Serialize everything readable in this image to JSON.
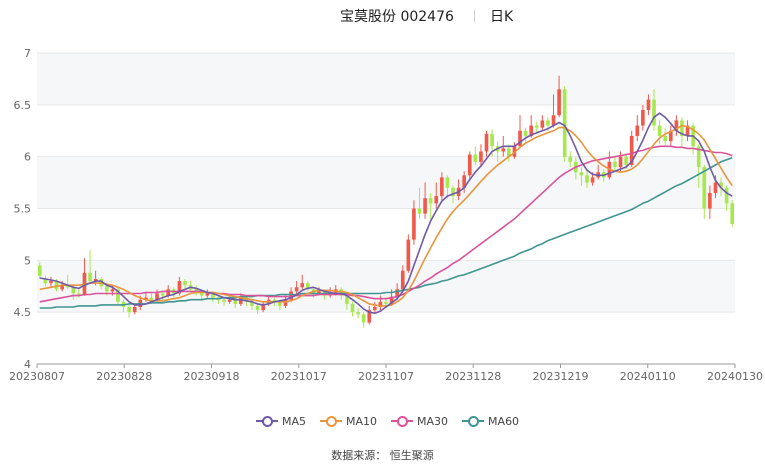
{
  "header": {
    "title": "宝莫股份 002476",
    "period": "日K"
  },
  "source": "数据来源： 恒生聚源",
  "colors": {
    "up": "#f0584a",
    "down": "#a6e84e",
    "ma5": "#6f5aa8",
    "ma10": "#e8953c",
    "ma30": "#d9539c",
    "ma60": "#3f9591",
    "grid": "#e8e8e8",
    "band": "#f6f7f9"
  },
  "chart_data": {
    "type": "candlestick",
    "ylim": [
      4,
      7
    ],
    "yticks": [
      "4",
      "4.5",
      "5",
      "5.5",
      "6",
      "6.5",
      "7"
    ],
    "xticks": [
      "20230807",
      "20230828",
      "20230918",
      "20231017",
      "20231107",
      "20231128",
      "20231219",
      "20240110",
      "20240130"
    ],
    "legend": [
      "MA5",
      "MA10",
      "MA30",
      "MA60"
    ],
    "candles": [
      [
        4.95,
        4.85,
        4.98,
        4.82
      ],
      [
        4.82,
        4.78,
        4.85,
        4.75
      ],
      [
        4.78,
        4.8,
        4.84,
        4.74
      ],
      [
        4.8,
        4.72,
        4.82,
        4.7
      ],
      [
        4.72,
        4.76,
        4.8,
        4.7
      ],
      [
        4.76,
        4.74,
        4.86,
        4.72
      ],
      [
        4.74,
        4.68,
        4.76,
        4.62
      ],
      [
        4.68,
        4.66,
        4.72,
        4.64
      ],
      [
        4.66,
        4.88,
        5.02,
        4.7
      ],
      [
        4.88,
        4.8,
        5.1,
        4.78
      ],
      [
        4.8,
        4.82,
        4.9,
        4.76
      ],
      [
        4.82,
        4.75,
        4.84,
        4.72
      ],
      [
        4.75,
        4.7,
        4.78,
        4.66
      ],
      [
        4.7,
        4.72,
        4.76,
        4.66
      ],
      [
        4.72,
        4.6,
        4.74,
        4.58
      ],
      [
        4.6,
        4.55,
        4.62,
        4.5
      ],
      [
        4.55,
        4.5,
        4.58,
        4.45
      ],
      [
        4.5,
        4.55,
        4.58,
        4.48
      ],
      [
        4.55,
        4.62,
        4.66,
        4.52
      ],
      [
        4.62,
        4.64,
        4.7,
        4.6
      ],
      [
        4.64,
        4.62,
        4.68,
        4.58
      ],
      [
        4.62,
        4.68,
        4.72,
        4.6
      ],
      [
        4.68,
        4.66,
        4.7,
        4.62
      ],
      [
        4.66,
        4.72,
        4.76,
        4.64
      ],
      [
        4.72,
        4.68,
        4.74,
        4.64
      ],
      [
        4.68,
        4.8,
        4.84,
        4.66
      ],
      [
        4.8,
        4.76,
        4.82,
        4.72
      ],
      [
        4.76,
        4.72,
        4.8,
        4.7
      ],
      [
        4.72,
        4.7,
        4.76,
        4.66
      ],
      [
        4.7,
        4.66,
        4.72,
        4.62
      ],
      [
        4.66,
        4.68,
        4.72,
        4.64
      ],
      [
        4.68,
        4.64,
        4.7,
        4.6
      ],
      [
        4.64,
        4.62,
        4.66,
        4.58
      ],
      [
        4.62,
        4.6,
        4.64,
        4.56
      ],
      [
        4.6,
        4.62,
        4.66,
        4.58
      ],
      [
        4.62,
        4.58,
        4.64,
        4.54
      ],
      [
        4.58,
        4.64,
        4.68,
        4.56
      ],
      [
        4.64,
        4.6,
        4.66,
        4.56
      ],
      [
        4.6,
        4.56,
        4.62,
        4.52
      ],
      [
        4.56,
        4.52,
        4.58,
        4.48
      ],
      [
        4.52,
        4.58,
        4.6,
        4.5
      ],
      [
        4.58,
        4.62,
        4.66,
        4.56
      ],
      [
        4.62,
        4.6,
        4.64,
        4.56
      ],
      [
        4.6,
        4.56,
        4.62,
        4.52
      ],
      [
        4.56,
        4.62,
        4.66,
        4.54
      ],
      [
        4.62,
        4.7,
        4.74,
        4.6
      ],
      [
        4.7,
        4.74,
        4.8,
        4.68
      ],
      [
        4.74,
        4.78,
        4.86,
        4.72
      ],
      [
        4.78,
        4.72,
        4.8,
        4.7
      ],
      [
        4.72,
        4.68,
        4.74,
        4.64
      ],
      [
        4.68,
        4.7,
        4.74,
        4.66
      ],
      [
        4.7,
        4.66,
        4.72,
        4.62
      ],
      [
        4.66,
        4.68,
        4.74,
        4.64
      ],
      [
        4.68,
        4.72,
        4.76,
        4.66
      ],
      [
        4.72,
        4.66,
        4.74,
        4.62
      ],
      [
        4.66,
        4.58,
        4.68,
        4.52
      ],
      [
        4.58,
        4.5,
        4.6,
        4.46
      ],
      [
        4.5,
        4.48,
        4.54,
        4.44
      ],
      [
        4.48,
        4.4,
        4.5,
        4.35
      ],
      [
        4.4,
        4.52,
        4.56,
        4.38
      ],
      [
        4.52,
        4.55,
        4.6,
        4.5
      ],
      [
        4.55,
        4.6,
        4.66,
        4.52
      ],
      [
        4.6,
        4.58,
        4.64,
        4.54
      ],
      [
        4.58,
        4.65,
        4.72,
        4.56
      ],
      [
        4.65,
        4.72,
        4.78,
        4.62
      ],
      [
        4.72,
        4.9,
        4.95,
        4.7
      ],
      [
        4.9,
        5.2,
        5.25,
        4.88
      ],
      [
        5.2,
        5.5,
        5.58,
        5.15
      ],
      [
        5.5,
        5.45,
        5.7,
        5.4
      ],
      [
        5.45,
        5.6,
        5.75,
        5.4
      ],
      [
        5.6,
        5.55,
        5.65,
        5.4
      ],
      [
        5.55,
        5.62,
        5.75,
        5.5
      ],
      [
        5.62,
        5.8,
        5.85,
        5.58
      ],
      [
        5.8,
        5.7,
        5.82,
        5.6
      ],
      [
        5.7,
        5.62,
        5.72,
        5.55
      ],
      [
        5.62,
        5.7,
        5.78,
        5.58
      ],
      [
        5.7,
        5.82,
        5.86,
        5.65
      ],
      [
        5.82,
        6.02,
        6.05,
        5.78
      ],
      [
        6.02,
        5.95,
        6.1,
        5.92
      ],
      [
        5.95,
        6.05,
        6.12,
        5.9
      ],
      [
        6.05,
        6.22,
        6.25,
        6.0
      ],
      [
        6.22,
        6.1,
        6.26,
        6.0
      ],
      [
        6.1,
        6.05,
        6.15,
        5.95
      ],
      [
        6.05,
        6.08,
        6.2,
        6.0
      ],
      [
        6.08,
        6.0,
        6.12,
        5.95
      ],
      [
        6.0,
        6.1,
        6.14,
        5.98
      ],
      [
        6.1,
        6.25,
        6.4,
        6.08
      ],
      [
        6.25,
        6.2,
        6.28,
        6.12
      ],
      [
        6.2,
        6.3,
        6.4,
        6.18
      ],
      [
        6.3,
        6.28,
        6.34,
        6.22
      ],
      [
        6.28,
        6.35,
        6.4,
        6.25
      ],
      [
        6.35,
        6.3,
        6.38,
        6.25
      ],
      [
        6.3,
        6.4,
        6.6,
        6.28
      ],
      [
        6.4,
        6.65,
        6.78,
        6.38
      ],
      [
        6.65,
        6.0,
        6.68,
        5.95
      ],
      [
        6.0,
        5.95,
        6.05,
        5.9
      ],
      [
        5.95,
        5.85,
        6.0,
        5.78
      ],
      [
        5.85,
        5.82,
        5.9,
        5.72
      ],
      [
        5.82,
        5.75,
        5.88,
        5.7
      ],
      [
        5.75,
        5.8,
        5.85,
        5.72
      ],
      [
        5.8,
        5.85,
        5.92,
        5.78
      ],
      [
        5.85,
        5.8,
        5.88,
        5.76
      ],
      [
        5.8,
        5.95,
        6.05,
        5.78
      ],
      [
        5.95,
        5.9,
        6.0,
        5.85
      ],
      [
        5.9,
        6.0,
        6.05,
        5.86
      ],
      [
        6.0,
        5.92,
        6.02,
        5.88
      ],
      [
        5.92,
        6.2,
        6.25,
        5.9
      ],
      [
        6.2,
        6.3,
        6.4,
        6.15
      ],
      [
        6.3,
        6.45,
        6.5,
        6.25
      ],
      [
        6.45,
        6.55,
        6.6,
        6.4
      ],
      [
        6.55,
        6.3,
        6.65,
        6.25
      ],
      [
        6.3,
        6.2,
        6.35,
        6.12
      ],
      [
        6.2,
        6.15,
        6.28,
        6.1
      ],
      [
        6.15,
        6.25,
        6.3,
        6.1
      ],
      [
        6.25,
        6.35,
        6.4,
        6.2
      ],
      [
        6.35,
        6.2,
        6.38,
        6.1
      ],
      [
        6.2,
        6.3,
        6.35,
        6.15
      ],
      [
        6.3,
        6.1,
        6.32,
        6.02
      ],
      [
        6.1,
        5.9,
        6.12,
        5.7
      ],
      [
        5.9,
        5.5,
        5.92,
        5.4
      ],
      [
        5.5,
        5.65,
        5.72,
        5.4
      ],
      [
        5.65,
        5.75,
        5.82,
        5.6
      ],
      [
        5.75,
        5.7,
        5.8,
        5.62
      ],
      [
        5.7,
        5.55,
        5.72,
        5.48
      ],
      [
        5.55,
        5.35,
        5.58,
        5.32
      ]
    ],
    "ma5": [
      4.83,
      4.82,
      4.81,
      4.8,
      4.78,
      4.76,
      4.74,
      4.73,
      4.76,
      4.78,
      4.8,
      4.8,
      4.76,
      4.74,
      4.7,
      4.65,
      4.6,
      4.57,
      4.57,
      4.58,
      4.6,
      4.62,
      4.64,
      4.66,
      4.67,
      4.7,
      4.72,
      4.74,
      4.73,
      4.71,
      4.69,
      4.68,
      4.66,
      4.64,
      4.63,
      4.62,
      4.62,
      4.61,
      4.6,
      4.58,
      4.57,
      4.58,
      4.6,
      4.61,
      4.62,
      4.64,
      4.67,
      4.71,
      4.73,
      4.74,
      4.72,
      4.7,
      4.69,
      4.68,
      4.68,
      4.66,
      4.62,
      4.58,
      4.53,
      4.5,
      4.49,
      4.51,
      4.55,
      4.59,
      4.63,
      4.7,
      4.8,
      4.95,
      5.1,
      5.25,
      5.38,
      5.48,
      5.57,
      5.62,
      5.64,
      5.66,
      5.7,
      5.78,
      5.85,
      5.91,
      5.98,
      6.05,
      6.08,
      6.1,
      6.1,
      6.1,
      6.14,
      6.18,
      6.21,
      6.23,
      6.25,
      6.27,
      6.3,
      6.33,
      6.3,
      6.2,
      6.08,
      5.95,
      5.87,
      5.83,
      5.82,
      5.82,
      5.84,
      5.86,
      5.88,
      5.9,
      5.95,
      6.05,
      6.16,
      6.28,
      6.38,
      6.42,
      6.38,
      6.32,
      6.25,
      6.22,
      6.2,
      6.2,
      6.15,
      6.05,
      5.9,
      5.77,
      5.7,
      5.65,
      5.62
    ],
    "ma10": [
      4.72,
      4.73,
      4.74,
      4.75,
      4.76,
      4.76,
      4.76,
      4.76,
      4.77,
      4.78,
      4.78,
      4.78,
      4.77,
      4.76,
      4.74,
      4.72,
      4.69,
      4.66,
      4.64,
      4.62,
      4.61,
      4.61,
      4.61,
      4.62,
      4.63,
      4.64,
      4.66,
      4.68,
      4.69,
      4.69,
      4.69,
      4.69,
      4.68,
      4.67,
      4.66,
      4.65,
      4.64,
      4.63,
      4.62,
      4.61,
      4.6,
      4.6,
      4.6,
      4.6,
      4.6,
      4.61,
      4.63,
      4.66,
      4.68,
      4.7,
      4.71,
      4.71,
      4.71,
      4.7,
      4.7,
      4.69,
      4.67,
      4.64,
      4.61,
      4.58,
      4.57,
      4.56,
      4.56,
      4.57,
      4.6,
      4.64,
      4.71,
      4.8,
      4.91,
      5.02,
      5.12,
      5.22,
      5.31,
      5.4,
      5.47,
      5.53,
      5.58,
      5.64,
      5.7,
      5.76,
      5.82,
      5.87,
      5.92,
      5.96,
      6.0,
      6.04,
      6.09,
      6.13,
      6.16,
      6.19,
      6.21,
      6.23,
      6.25,
      6.28,
      6.28,
      6.25,
      6.2,
      6.14,
      6.06,
      6.0,
      5.95,
      5.91,
      5.88,
      5.86,
      5.85,
      5.86,
      5.88,
      5.92,
      5.98,
      6.05,
      6.12,
      6.18,
      6.22,
      6.24,
      6.27,
      6.3,
      6.29,
      6.26,
      6.22,
      6.16,
      6.07,
      5.98,
      5.89,
      5.8,
      5.72
    ],
    "ma30": [
      4.6,
      4.61,
      4.62,
      4.63,
      4.64,
      4.65,
      4.66,
      4.66,
      4.67,
      4.67,
      4.68,
      4.68,
      4.68,
      4.68,
      4.68,
      4.68,
      4.68,
      4.68,
      4.68,
      4.69,
      4.69,
      4.69,
      4.7,
      4.7,
      4.7,
      4.7,
      4.7,
      4.7,
      4.7,
      4.7,
      4.69,
      4.69,
      4.68,
      4.68,
      4.67,
      4.67,
      4.67,
      4.66,
      4.66,
      4.66,
      4.66,
      4.65,
      4.65,
      4.65,
      4.65,
      4.65,
      4.66,
      4.66,
      4.66,
      4.66,
      4.67,
      4.67,
      4.67,
      4.67,
      4.67,
      4.67,
      4.66,
      4.66,
      4.65,
      4.64,
      4.63,
      4.63,
      4.63,
      4.64,
      4.65,
      4.67,
      4.7,
      4.73,
      4.76,
      4.8,
      4.83,
      4.87,
      4.9,
      4.93,
      4.97,
      5.0,
      5.04,
      5.08,
      5.12,
      5.16,
      5.2,
      5.24,
      5.28,
      5.32,
      5.36,
      5.4,
      5.45,
      5.5,
      5.55,
      5.6,
      5.65,
      5.7,
      5.75,
      5.8,
      5.84,
      5.87,
      5.9,
      5.92,
      5.94,
      5.96,
      5.97,
      5.98,
      5.99,
      6.0,
      6.01,
      6.02,
      6.03,
      6.05,
      6.06,
      6.08,
      6.09,
      6.1,
      6.1,
      6.1,
      6.09,
      6.09,
      6.08,
      6.08,
      6.07,
      6.06,
      6.05,
      6.04,
      6.04,
      6.03,
      6.01
    ],
    "ma60": [
      4.54,
      4.54,
      4.54,
      4.55,
      4.55,
      4.55,
      4.55,
      4.56,
      4.56,
      4.56,
      4.56,
      4.57,
      4.57,
      4.57,
      4.57,
      4.57,
      4.58,
      4.58,
      4.58,
      4.58,
      4.59,
      4.59,
      4.59,
      4.6,
      4.6,
      4.61,
      4.61,
      4.62,
      4.62,
      4.62,
      4.63,
      4.63,
      4.63,
      4.64,
      4.64,
      4.64,
      4.65,
      4.65,
      4.65,
      4.66,
      4.66,
      4.66,
      4.66,
      4.67,
      4.67,
      4.67,
      4.67,
      4.68,
      4.68,
      4.68,
      4.68,
      4.68,
      4.68,
      4.68,
      4.68,
      4.68,
      4.68,
      4.68,
      4.68,
      4.68,
      4.68,
      4.68,
      4.69,
      4.69,
      4.7,
      4.71,
      4.72,
      4.73,
      4.74,
      4.76,
      4.77,
      4.78,
      4.8,
      4.81,
      4.83,
      4.85,
      4.86,
      4.88,
      4.9,
      4.92,
      4.94,
      4.96,
      4.98,
      5.0,
      5.02,
      5.04,
      5.07,
      5.09,
      5.11,
      5.14,
      5.16,
      5.19,
      5.21,
      5.23,
      5.25,
      5.27,
      5.29,
      5.31,
      5.33,
      5.35,
      5.37,
      5.39,
      5.41,
      5.43,
      5.45,
      5.47,
      5.49,
      5.52,
      5.55,
      5.57,
      5.6,
      5.63,
      5.66,
      5.69,
      5.72,
      5.74,
      5.77,
      5.8,
      5.83,
      5.86,
      5.89,
      5.92,
      5.95,
      5.97,
      5.99
    ]
  }
}
